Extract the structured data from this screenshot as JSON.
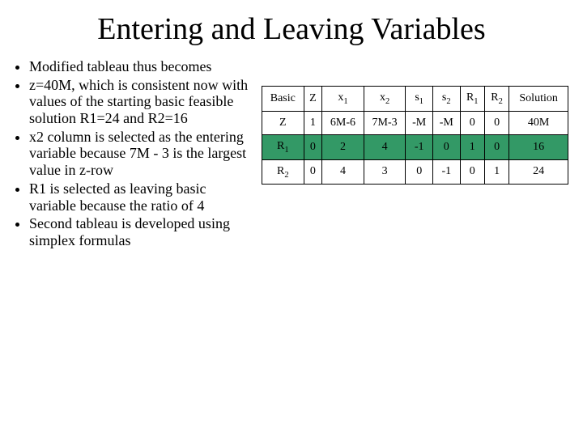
{
  "title": "Entering and Leaving Variables",
  "bullets": [
    "Modified tableau thus becomes",
    "z=40M, which is consistent now with values of the starting basic feasible solution R1=24 and R2=16",
    "x2 column is selected as the entering variable because 7M - 3 is the largest value in z-row",
    "R1 is selected as leaving basic variable because the ratio of 4",
    "Second tableau is developed using simplex formulas"
  ],
  "table": {
    "headers": [
      "Basic",
      "Z",
      "x1",
      "x2",
      "s1",
      "s2",
      "R1",
      "R2",
      "Solution"
    ],
    "rows": [
      {
        "cells": [
          "Z",
          "1",
          "6M-6",
          "7M-3",
          "-M",
          "-M",
          "0",
          "0",
          "40M"
        ],
        "green": false
      },
      {
        "cells": [
          "R1",
          "0",
          "2",
          "4",
          "-1",
          "0",
          "1",
          "0",
          "16"
        ],
        "green": true
      },
      {
        "cells": [
          "R2",
          "0",
          "4",
          "3",
          "0",
          "-1",
          "0",
          "1",
          "24"
        ],
        "green": false
      }
    ]
  }
}
